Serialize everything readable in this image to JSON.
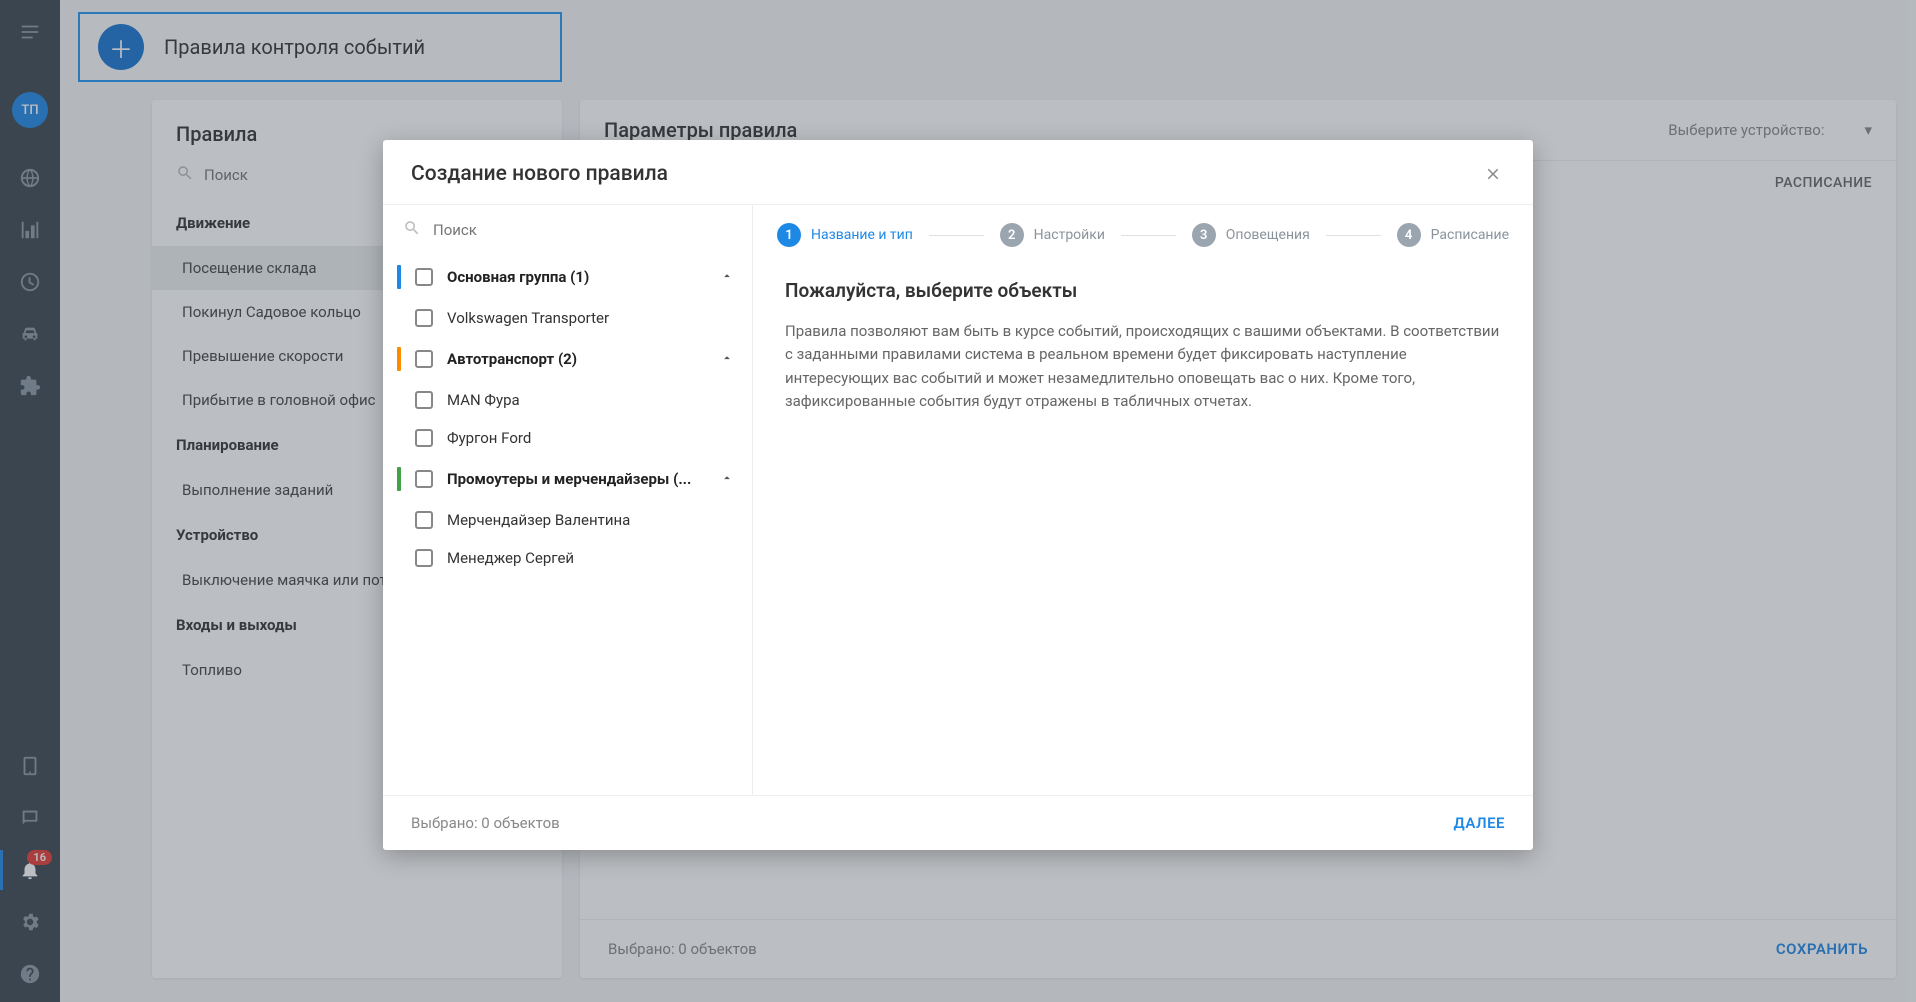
{
  "page": {
    "title": "Правила контроля событий"
  },
  "rail": {
    "avatar": "ТП",
    "badge": "16"
  },
  "rules_panel": {
    "title": "Правила",
    "search_placeholder": "Поиск",
    "sections": [
      {
        "name": "Движение",
        "items": [
          "Посещение склада",
          "Покинул Садовое кольцо",
          "Превышение скорости",
          "Прибытие в головной офис"
        ]
      },
      {
        "name": "Планирование",
        "items": [
          "Выполнение заданий"
        ]
      },
      {
        "name": "Устройство",
        "items": [
          "Выключение маячка или потеря связи"
        ]
      },
      {
        "name": "Входы и выходы",
        "items": [
          "Топливо"
        ]
      }
    ]
  },
  "params_panel": {
    "title": "Параметры правила",
    "device_label": "Выберите устройство:",
    "tab_schedule": "РАСПИСАНИЕ",
    "selected_label": "Выбрано: 0 объектов",
    "save_label": "СОХРАНИТЬ"
  },
  "modal": {
    "title": "Создание нового правила",
    "search_placeholder": "Поиск",
    "groups": [
      {
        "label": "Основная группа (1)",
        "color": "blue",
        "items": [
          "Volkswagen Transporter"
        ]
      },
      {
        "label": "Автотранспорт (2)",
        "color": "orange",
        "items": [
          "MAN Фура",
          "Фургон Ford"
        ]
      },
      {
        "label": "Промоутеры и мерчендайзеры (...",
        "color": "green",
        "items": [
          "Мерчендайзер Валентина",
          "Менеджер Сергей"
        ]
      }
    ],
    "steps": [
      {
        "num": "1",
        "label": "Название и тип"
      },
      {
        "num": "2",
        "label": "Настройки"
      },
      {
        "num": "3",
        "label": "Оповещения"
      },
      {
        "num": "4",
        "label": "Расписание"
      }
    ],
    "content_title": "Пожалуйста, выберите объекты",
    "content_text": "Правила позволяют вам быть в курсе событий, происходящих с вашими объектами. В соответствии с заданными правилами система в реальном времени будет фиксировать наступление интересующих вас событий и может незамедлительно оповещать вас о них. Кроме того, зафиксированные события будут отражены в табличных отчетах.",
    "selected_label": "Выбрано: 0 объектов",
    "next_label": "ДАЛЕЕ"
  }
}
